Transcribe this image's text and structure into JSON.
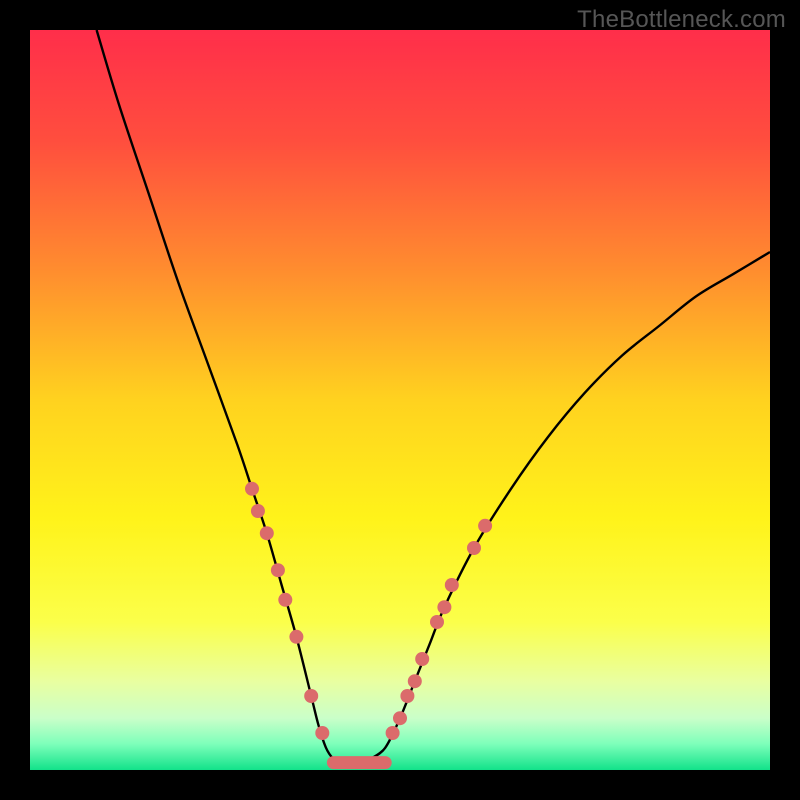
{
  "watermark": "TheBottleneck.com",
  "gradient": {
    "stops": [
      {
        "offset": 0.0,
        "color": "#ff2e4a"
      },
      {
        "offset": 0.15,
        "color": "#ff4e3e"
      },
      {
        "offset": 0.32,
        "color": "#ff8b2f"
      },
      {
        "offset": 0.5,
        "color": "#ffd21f"
      },
      {
        "offset": 0.66,
        "color": "#fff31a"
      },
      {
        "offset": 0.8,
        "color": "#fbff4a"
      },
      {
        "offset": 0.88,
        "color": "#e9ffa0"
      },
      {
        "offset": 0.93,
        "color": "#caffc9"
      },
      {
        "offset": 0.965,
        "color": "#7dffba"
      },
      {
        "offset": 1.0,
        "color": "#12e28a"
      }
    ]
  },
  "chart_data": {
    "type": "line",
    "title": "",
    "xlabel": "",
    "ylabel": "",
    "xlim": [
      0,
      100
    ],
    "ylim": [
      0,
      100
    ],
    "legend": false,
    "grid": false,
    "series": [
      {
        "name": "bottleneck-curve",
        "x": [
          9,
          12,
          16,
          20,
          24,
          28,
          30,
          32,
          34,
          36,
          38,
          39,
          40,
          41,
          42,
          43,
          44,
          45,
          46,
          48,
          50,
          52,
          54,
          56,
          60,
          65,
          70,
          75,
          80,
          85,
          90,
          95,
          100
        ],
        "y": [
          100,
          90,
          78,
          66,
          55,
          44,
          38,
          32,
          25,
          18,
          10,
          6,
          3,
          1.5,
          1,
          1,
          1,
          1,
          1.5,
          3,
          7,
          12,
          17,
          22,
          30,
          38,
          45,
          51,
          56,
          60,
          64,
          67,
          70
        ]
      }
    ],
    "flat_segment": {
      "x0": 41,
      "x1": 48,
      "y": 1
    },
    "markers_left": [
      {
        "x": 30.0,
        "y": 38
      },
      {
        "x": 30.8,
        "y": 35
      },
      {
        "x": 32.0,
        "y": 32
      },
      {
        "x": 33.5,
        "y": 27
      },
      {
        "x": 34.5,
        "y": 23
      },
      {
        "x": 36.0,
        "y": 18
      },
      {
        "x": 38.0,
        "y": 10
      },
      {
        "x": 39.5,
        "y": 5
      }
    ],
    "markers_right": [
      {
        "x": 49.0,
        "y": 5
      },
      {
        "x": 50.0,
        "y": 7
      },
      {
        "x": 51.0,
        "y": 10
      },
      {
        "x": 52.0,
        "y": 12
      },
      {
        "x": 53.0,
        "y": 15
      },
      {
        "x": 55.0,
        "y": 20
      },
      {
        "x": 56.0,
        "y": 22
      },
      {
        "x": 57.0,
        "y": 25
      },
      {
        "x": 60.0,
        "y": 30
      },
      {
        "x": 61.5,
        "y": 33
      }
    ],
    "marker_style": {
      "r": 7,
      "fill": "#db6b6b"
    },
    "flat_style": {
      "stroke": "#db6b6b",
      "width": 13
    },
    "curve_style": {
      "stroke": "#000000",
      "width": 2.4
    }
  }
}
